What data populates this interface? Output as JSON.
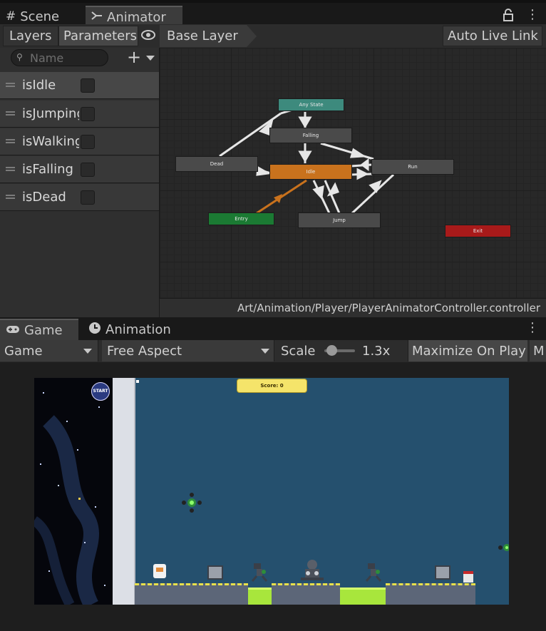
{
  "top_tabs": [
    {
      "label": "Scene",
      "icon": "grid-icon"
    },
    {
      "label": "Animator",
      "icon": "animator-icon"
    }
  ],
  "animator": {
    "layers_tab": "Layers",
    "parameters_tab": "Parameters",
    "search_placeholder": "Name",
    "breadcrumb": "Base Layer",
    "auto_live_link": "Auto Live Link",
    "parameters": [
      {
        "name": "isIdle",
        "type": "bool",
        "value": false
      },
      {
        "name": "isJumping",
        "type": "bool",
        "value": false
      },
      {
        "name": "isWalking",
        "type": "bool",
        "value": false
      },
      {
        "name": "isFalling",
        "type": "bool",
        "value": false
      },
      {
        "name": "isDead",
        "type": "bool",
        "value": false
      }
    ],
    "states": {
      "any_state": "Any State",
      "falling": "Falling",
      "dead": "Dead",
      "idle": "Idle",
      "run": "Run",
      "entry": "Entry",
      "jump": "Jump",
      "exit": "Exit"
    },
    "controller_path": "Art/Animation/Player/PlayerAnimatorController.controller"
  },
  "bottom_tabs": [
    {
      "label": "Game",
      "icon": "gamepad-icon"
    },
    {
      "label": "Animation",
      "icon": "clock-icon"
    }
  ],
  "game_toolbar": {
    "display": "Game",
    "aspect": "Free Aspect",
    "scale_label": "Scale",
    "scale_value": "1.3x",
    "maximize": "Maximize On Play",
    "cut_off": "M"
  },
  "game": {
    "score_text": "Score: 0",
    "start_badge": "START"
  },
  "colors": {
    "any_state": "#3d8a7d",
    "idle": "#c9721d",
    "entry": "#1b7a33",
    "exit": "#a81a1a",
    "state_default": "#4a4a4a",
    "sky": "#25506e"
  }
}
